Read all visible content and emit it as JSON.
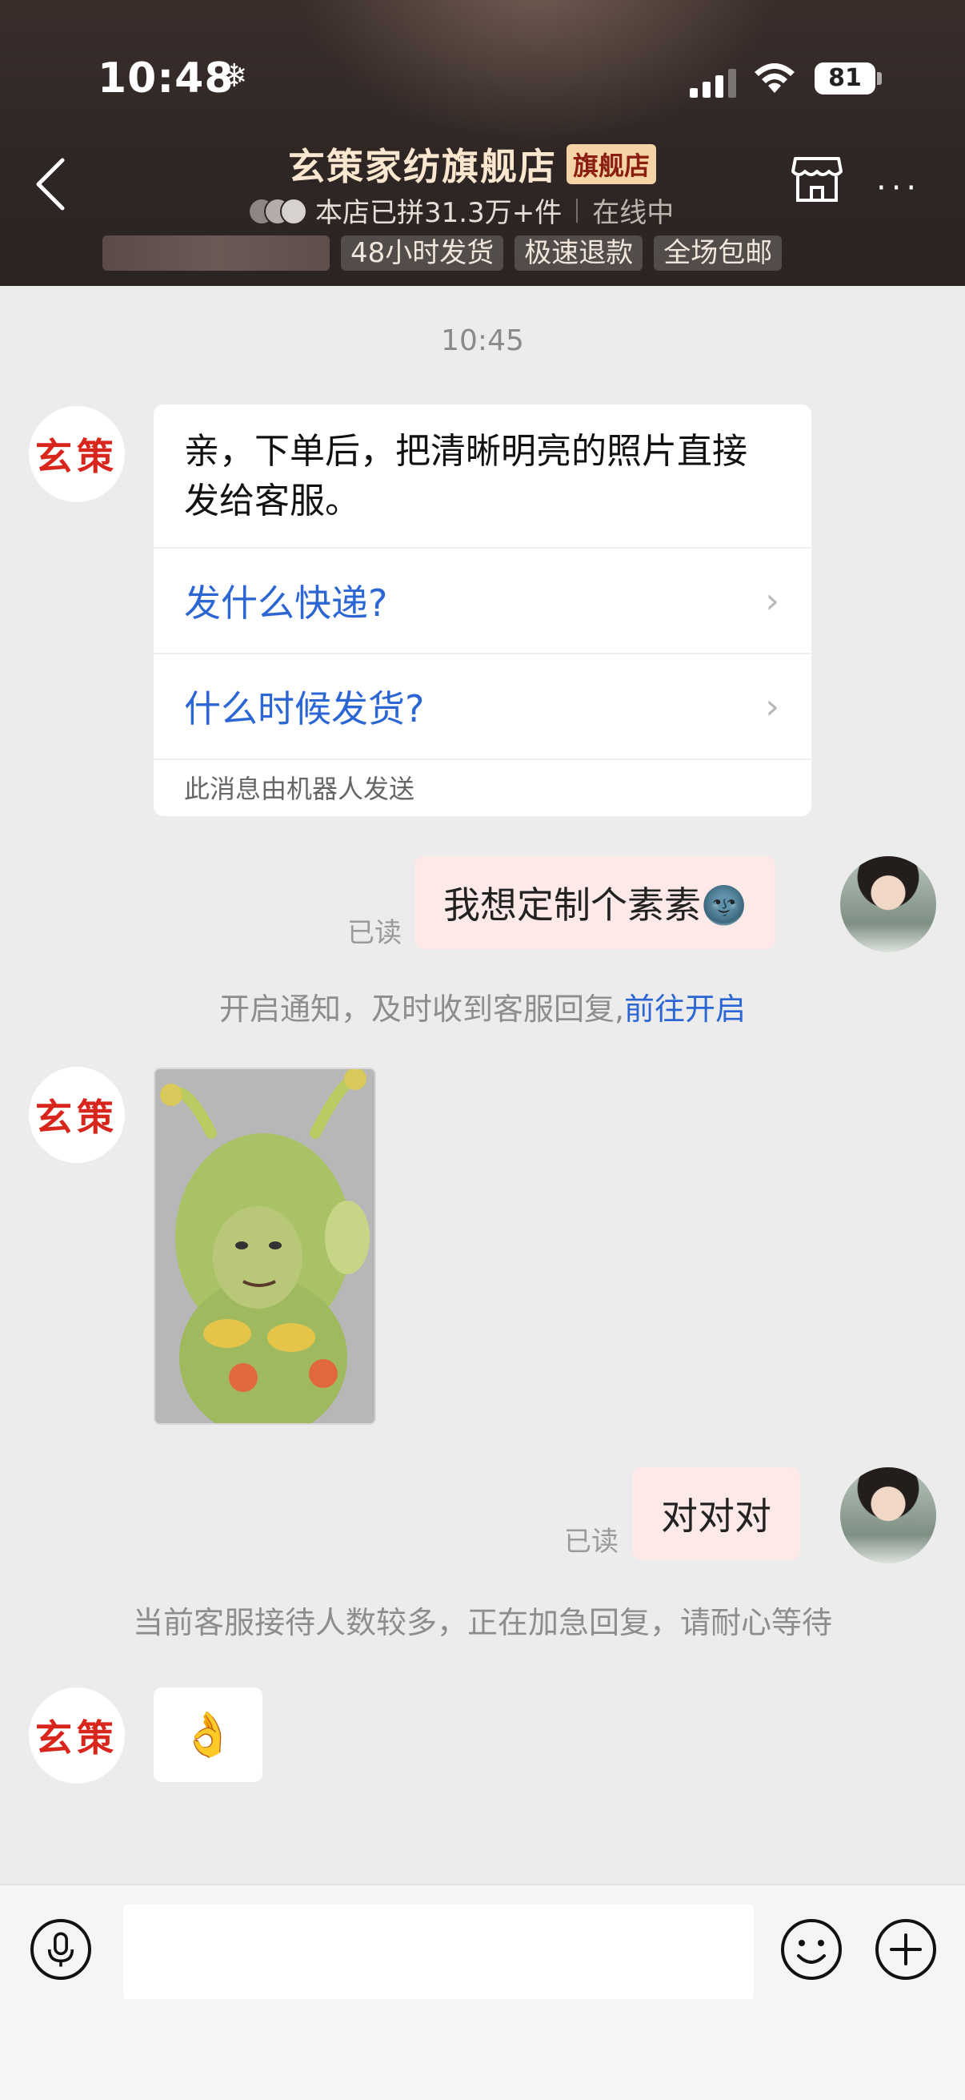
{
  "status_bar": {
    "time": "10:48",
    "snow_icon": "❄",
    "battery": "81"
  },
  "header": {
    "store_name": "玄策家纺旗舰店",
    "badge": "旗舰店",
    "stats": "本店已拼31.3万+件",
    "online": "在线中",
    "tags": [
      "48小时发货",
      "极速退款",
      "全场包邮"
    ]
  },
  "chat": {
    "timestamp": "10:45",
    "shop_avatar_text": "玄策",
    "bot_card": {
      "message": "亲，下单后，把清晰明亮的照片直接发给客服。",
      "options": [
        "发什么快递?",
        "什么时候发货?"
      ],
      "chevron": "›",
      "note": "此消息由机器人发送"
    },
    "my_message_1": {
      "text": "我想定制个素素🌚",
      "status": "已读"
    },
    "notice": {
      "text": "开启通知，及时收到客服回复,",
      "link": "前往开启"
    },
    "my_message_2": {
      "text": "对对对",
      "status": "已读"
    },
    "wait_notice": "当前客服接待人数较多，正在加急回复，请耐心等待",
    "small_sticker": "👌"
  },
  "icons": [
    "back-icon",
    "store-icon",
    "more-icon",
    "mic-icon",
    "emoji-icon",
    "plus-icon",
    "wifi-icon",
    "signal-icon"
  ],
  "colors": {
    "header_bg": "#2e2624",
    "badge_bg": "#f6d3a6",
    "link": "#2b66d4",
    "my_bubble": "#fde9e8",
    "brand_red": "#d8261c"
  }
}
